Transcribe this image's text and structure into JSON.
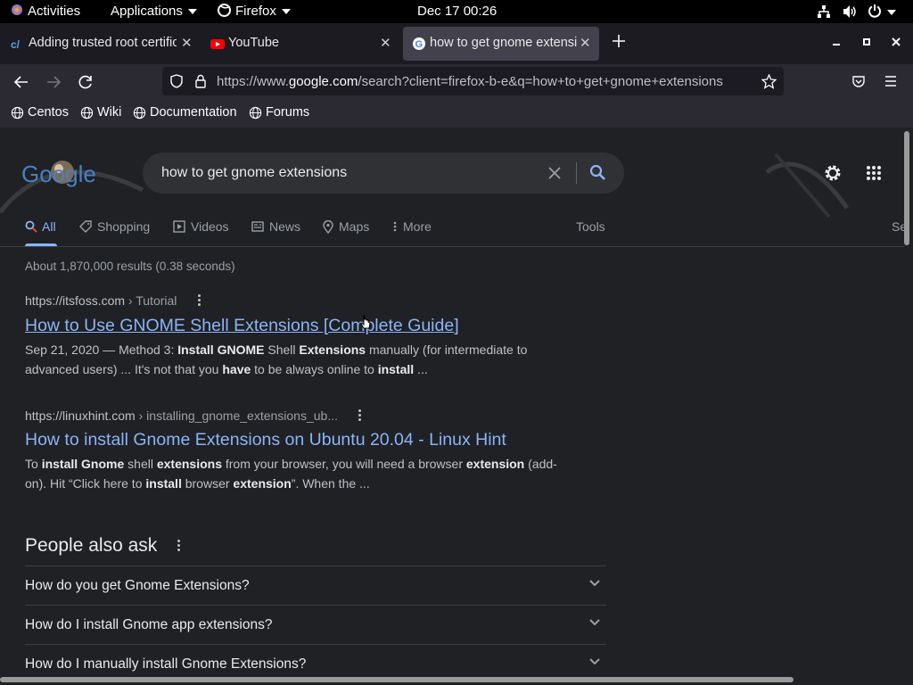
{
  "system": {
    "activities": "Activities",
    "applications": "Applications",
    "firefox_menu": "Firefox",
    "clock": "Dec 17  00:26"
  },
  "tabs": [
    {
      "title": "Adding trusted root certific"
    },
    {
      "title": "YouTube"
    },
    {
      "title": "how to get gnome extensi"
    }
  ],
  "url": {
    "prefix": "https://www.",
    "domain": "google.com",
    "rest": "/search?client=firefox-b-e&q=how+to+get+gnome+extensions"
  },
  "bookmarks": [
    "Centos",
    "Wiki",
    "Documentation",
    "Forums"
  ],
  "google": {
    "logo": "Google",
    "query": "how to get gnome extensions",
    "tabs": {
      "all": "All",
      "shopping": "Shopping",
      "videos": "Videos",
      "news": "News",
      "maps": "Maps",
      "more": "More",
      "tools": "Tools",
      "safesearch_partial": "Se"
    },
    "stats": "About 1,870,000 results (0.38 seconds)",
    "results": [
      {
        "cite_host": "https://itsfoss.com",
        "cite_path": " › Tutorial",
        "title": "How to Use GNOME Shell Extensions [Complete Guide]",
        "snippet_html": "Sep 21, 2020 — Method 3: <b>Install GNOME</b> Shell <b>Extensions</b> manually (for intermediate to advanced users) ... It's not that you <b>have</b> to be always online to <b>install</b> ..."
      },
      {
        "cite_host": "https://linuxhint.com",
        "cite_path": " › installing_gnome_extensions_ub...",
        "title": "How to install Gnome Extensions on Ubuntu 20.04 - Linux Hint",
        "snippet_html": "To <b>install Gnome</b> shell <b>extensions</b> from your browser, you will need a browser <b>extension</b> (add-on). Hit “Click here to <b>install</b> browser <b>extension</b>”. When the ..."
      }
    ],
    "paa_title": "People also ask",
    "paa": [
      "How do you get Gnome Extensions?",
      "How do I install Gnome app extensions?",
      "How do I manually install Gnome Extensions?"
    ]
  }
}
